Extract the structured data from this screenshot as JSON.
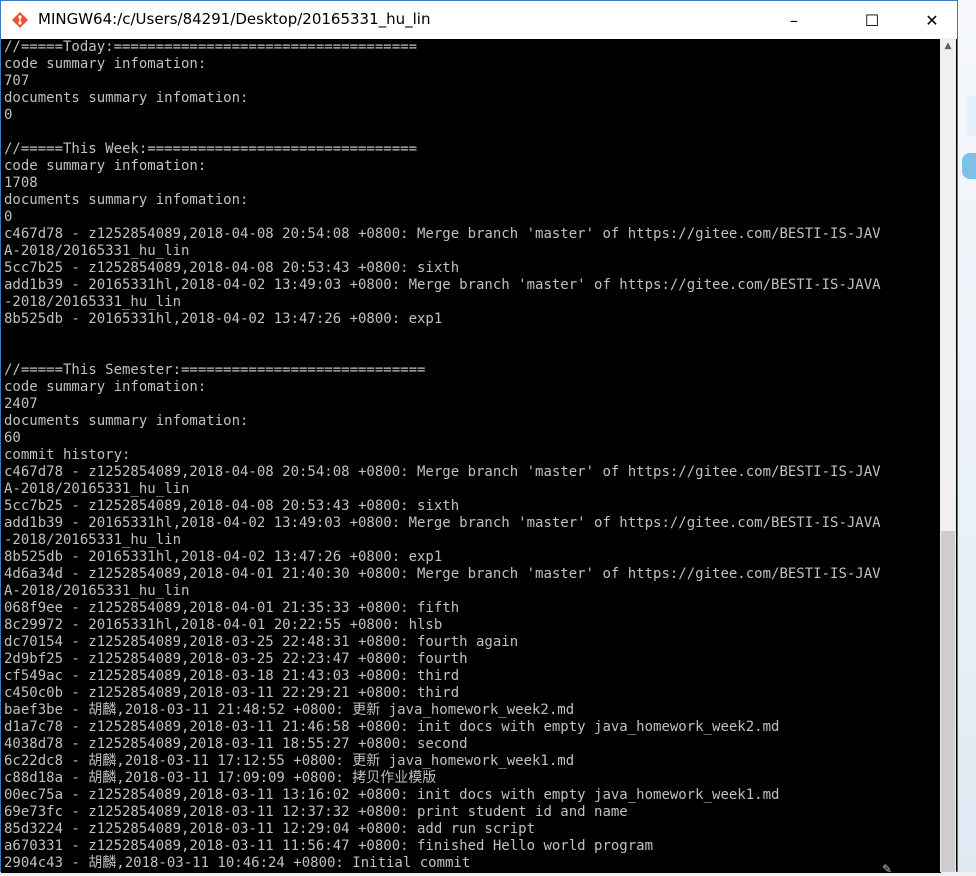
{
  "window": {
    "title": "MINGW64:/c/Users/84291/Desktop/20165331_hu_lin",
    "icon": "git-bash-icon",
    "controls": {
      "minimize": "–",
      "maximize": "☐",
      "close": "✕"
    }
  },
  "terminal": {
    "lines": [
      "//=====Today:====================================",
      "code summary infomation:",
      "707",
      "documents summary infomation:",
      "0",
      "",
      "//=====This Week:================================",
      "code summary infomation:",
      "1708",
      "documents summary infomation:",
      "0",
      "c467d78 - z1252854089,2018-04-08 20:54:08 +0800: Merge branch 'master' of https://gitee.com/BESTI-IS-JAV",
      "A-2018/20165331_hu_lin",
      "5cc7b25 - z1252854089,2018-04-08 20:53:43 +0800: sixth",
      "add1b39 - 20165331hl,2018-04-02 13:49:03 +0800: Merge branch 'master' of https://gitee.com/BESTI-IS-JAVA",
      "-2018/20165331_hu_lin",
      "8b525db - 20165331hl,2018-04-02 13:47:26 +0800: exp1",
      "",
      "",
      "//=====This Semester:=============================",
      "code summary infomation:",
      "2407",
      "documents summary infomation:",
      "60",
      "commit history:",
      "c467d78 - z1252854089,2018-04-08 20:54:08 +0800: Merge branch 'master' of https://gitee.com/BESTI-IS-JAV",
      "A-2018/20165331_hu_lin",
      "5cc7b25 - z1252854089,2018-04-08 20:53:43 +0800: sixth",
      "add1b39 - 20165331hl,2018-04-02 13:49:03 +0800: Merge branch 'master' of https://gitee.com/BESTI-IS-JAVA",
      "-2018/20165331_hu_lin",
      "8b525db - 20165331hl,2018-04-02 13:47:26 +0800: exp1",
      "4d6a34d - z1252854089,2018-04-01 21:40:30 +0800: Merge branch 'master' of https://gitee.com/BESTI-IS-JAV",
      "A-2018/20165331_hu_lin",
      "068f9ee - z1252854089,2018-04-01 21:35:33 +0800: fifth",
      "8c29972 - 20165331hl,2018-04-01 20:22:55 +0800: hlsb",
      "dc70154 - z1252854089,2018-03-25 22:48:31 +0800: fourth again",
      "2d9bf25 - z1252854089,2018-03-25 22:23:47 +0800: fourth",
      "cf549ac - z1252854089,2018-03-18 21:43:03 +0800: third",
      "c450c0b - z1252854089,2018-03-11 22:29:21 +0800: third",
      "baef3be - 胡麟,2018-03-11 21:48:52 +0800: 更新 java_homework_week2.md",
      "d1a7c78 - z1252854089,2018-03-11 21:46:58 +0800: init docs with empty java_homework_week2.md",
      "4038d78 - z1252854089,2018-03-11 18:55:27 +0800: second",
      "6c22dc8 - 胡麟,2018-03-11 17:12:55 +0800: 更新 java_homework_week1.md",
      "c88d18a - 胡麟,2018-03-11 17:09:09 +0800: 拷贝作业模版",
      "00ec75a - z1252854089,2018-03-11 13:16:02 +0800: init docs with empty java_homework_week1.md",
      "69e73fc - z1252854089,2018-03-11 12:37:32 +0800: print student id and name",
      "85d3224 - z1252854089,2018-03-11 12:29:04 +0800: add run script",
      "a670331 - z1252854089,2018-03-11 11:56:47 +0800: finished Hello world program",
      "2904c43 - 胡麟,2018-03-11 10:46:24 +0800: Initial commit"
    ]
  },
  "colors": {
    "terminal_bg": "#000000",
    "terminal_fg": "#c0c0c0",
    "titlebar_bg": "#ffffff"
  }
}
